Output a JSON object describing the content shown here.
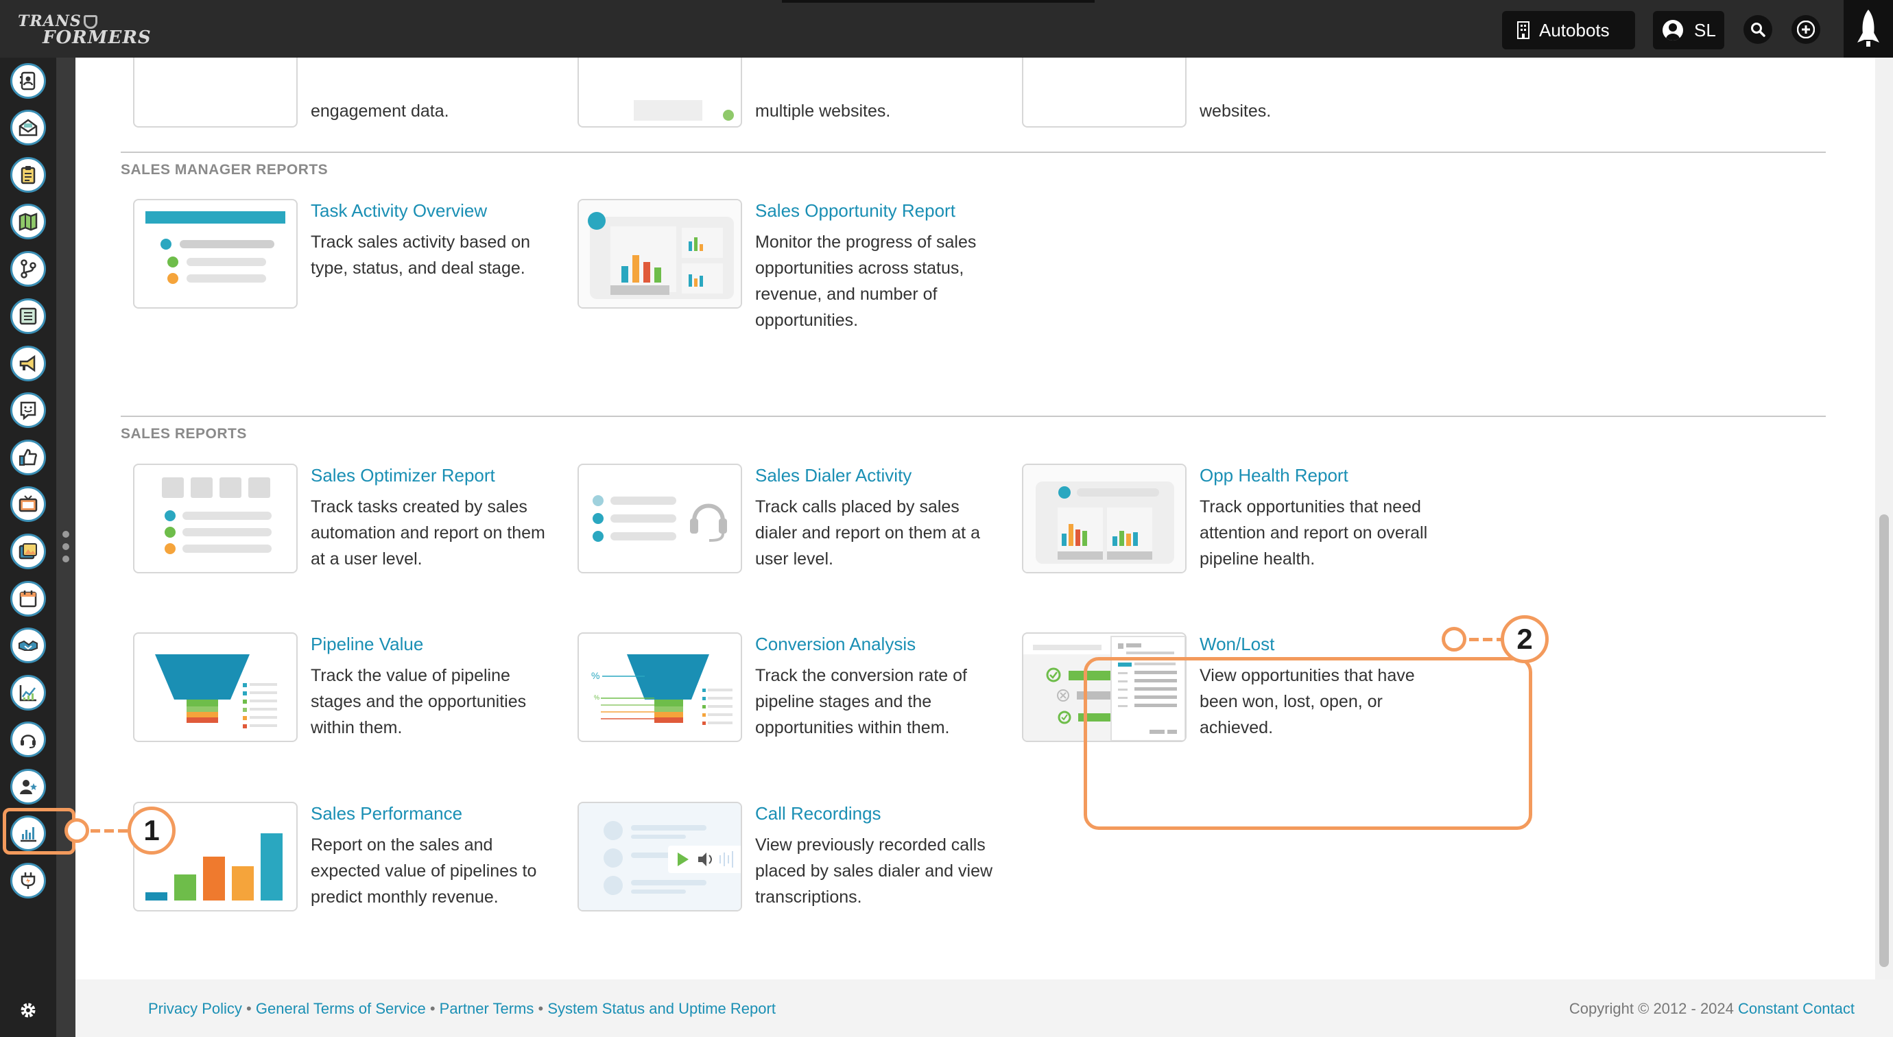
{
  "header": {
    "logo_line1": "TRANS",
    "logo_line2": "FORMERS",
    "org_button": "Autobots",
    "user_initials": "SL"
  },
  "top_partial": [
    {
      "text": "engagement data."
    },
    {
      "text": "multiple websites."
    },
    {
      "text": "websites."
    }
  ],
  "sections": [
    {
      "title": "SALES MANAGER REPORTS",
      "cards": [
        {
          "title": "Task Activity Overview",
          "desc": "Track sales activity based on type, status, and deal stage."
        },
        {
          "title": "Sales Opportunity Report",
          "desc": "Monitor the progress of sales opportunities across status, revenue, and number of opportunities."
        }
      ]
    },
    {
      "title": "SALES REPORTS",
      "cards": [
        {
          "title": "Sales Optimizer Report",
          "desc": "Track tasks created by sales automation and report on them at a user level."
        },
        {
          "title": "Sales Dialer Activity",
          "desc": "Track calls placed by sales dialer and report on them at a user level."
        },
        {
          "title": "Opp Health Report",
          "desc": "Track opportunities that need attention and report on overall pipeline health."
        },
        {
          "title": "Pipeline Value",
          "desc": "Track the value of pipeline stages and the opportunities within them."
        },
        {
          "title": "Conversion Analysis",
          "desc": "Track the conversion rate of pipeline stages and the opportunities within them."
        },
        {
          "title": "Won/Lost",
          "desc": "View opportunities that have been won, lost, open, or achieved."
        },
        {
          "title": "Sales Performance",
          "desc": "Report on the sales and expected value of pipelines to predict monthly revenue."
        },
        {
          "title": "Call Recordings",
          "desc": "View previously recorded calls placed by sales dialer and view transcriptions."
        }
      ]
    }
  ],
  "callouts": {
    "one": "1",
    "two": "2"
  },
  "footer": {
    "links": [
      "Privacy Policy",
      "General Terms of Service",
      "Partner Terms",
      "System Status and Uptime Report"
    ],
    "separator": "•",
    "copyright": "Copyright © 2012 - 2024",
    "company": "Constant Contact"
  },
  "sidebar_icons": [
    "contacts-icon",
    "email-icon",
    "clipboard-icon",
    "map-icon",
    "branch-icon",
    "list-icon",
    "megaphone-icon",
    "smile-icon",
    "thumbs-up-icon",
    "tv-icon",
    "image-icon",
    "calendar-icon",
    "handshake-icon",
    "trend-icon",
    "headset-icon",
    "user-star-icon",
    "reports-icon",
    "plug-icon"
  ],
  "colors": {
    "accent": "#1a8fb4",
    "highlight": "#f39a5c",
    "sidebar_ring": "#3b8fb5"
  }
}
